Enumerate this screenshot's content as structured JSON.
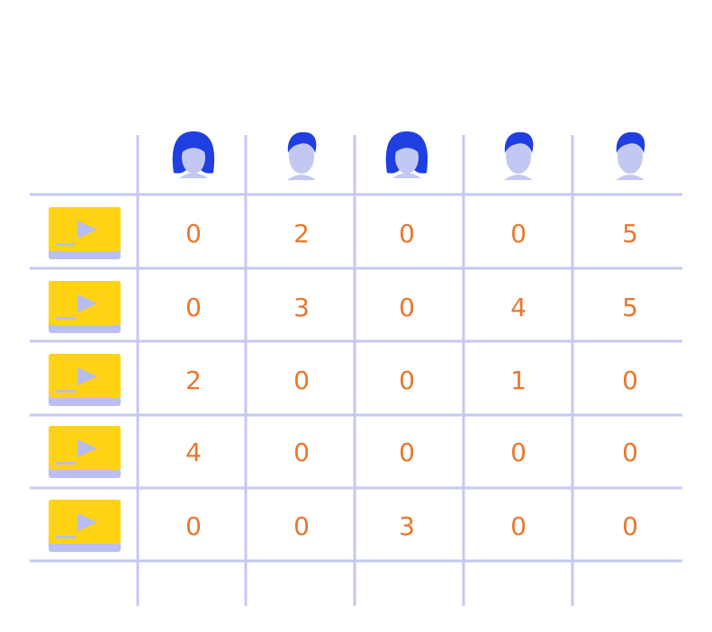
{
  "colors": {
    "grid": "#c4c9f0",
    "value": "#e8772e",
    "video_body": "#ffd314",
    "video_base": "#b9bff0",
    "video_play": "#b6bdf2",
    "face": "#c3c8f3",
    "hair": "#1f3fe0"
  },
  "users": [
    {
      "avatar": "female-user-icon"
    },
    {
      "avatar": "male-user-icon"
    },
    {
      "avatar": "female-user-icon"
    },
    {
      "avatar": "male-user-icon"
    },
    {
      "avatar": "male-user-icon"
    }
  ],
  "items": [
    {
      "icon": "video-play-icon",
      "ratings": [
        "0",
        "2",
        "0",
        "0",
        "5"
      ]
    },
    {
      "icon": "video-play-icon",
      "ratings": [
        "0",
        "3",
        "0",
        "4",
        "5"
      ]
    },
    {
      "icon": "video-play-icon",
      "ratings": [
        "2",
        "0",
        "0",
        "1",
        "0"
      ]
    },
    {
      "icon": "video-play-icon",
      "ratings": [
        "4",
        "0",
        "0",
        "0",
        "0"
      ]
    },
    {
      "icon": "video-play-icon",
      "ratings": [
        "0",
        "0",
        "3",
        "0",
        "0"
      ]
    }
  ]
}
